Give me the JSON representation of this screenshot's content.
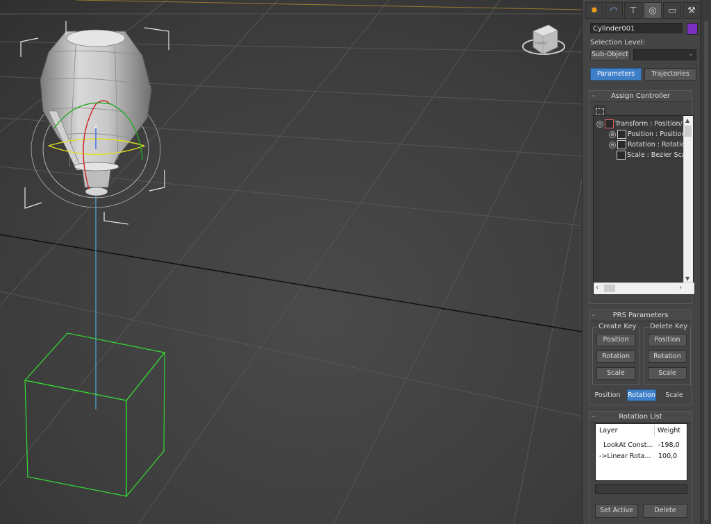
{
  "panel": {
    "tabs": [
      {
        "icon": "create-icon",
        "glyph": "✸",
        "active": false
      },
      {
        "icon": "modify-icon",
        "glyph": "◠",
        "active": false
      },
      {
        "icon": "hierarchy-icon",
        "glyph": "⊤",
        "active": false
      },
      {
        "icon": "motion-icon",
        "glyph": "◎",
        "active": true
      },
      {
        "icon": "display-icon",
        "glyph": "▭",
        "active": false
      },
      {
        "icon": "utilities-icon",
        "glyph": "⚒",
        "active": false
      }
    ],
    "object_name": "Cylinder001",
    "object_color": "#7a2fbf",
    "selection_level_label": "Selection Level:",
    "sub_object_button": "Sub-Object",
    "sub_object_dropdown_value": "",
    "parameters_button": "Parameters",
    "trajectories_button": "Trajectories"
  },
  "assign_controller": {
    "title": "Assign Controller",
    "collapse_symbol": "-",
    "tree": [
      {
        "expander": "⊖",
        "label": "Transform : Position/"
      },
      {
        "expander": "⊕",
        "label": "Position : Position"
      },
      {
        "expander": "⊕",
        "label": "Rotation : Rotatio"
      },
      {
        "expander": "",
        "label": "Scale : Bezier Sca"
      }
    ]
  },
  "prs_parameters": {
    "title": "PRS Parameters",
    "collapse_symbol": "-",
    "create_key_label": "Create Key",
    "delete_key_label": "Delete Key",
    "create_buttons": [
      "Position",
      "Rotation",
      "Scale"
    ],
    "delete_buttons": [
      "Position",
      "Rotation",
      "Scale"
    ],
    "mode_buttons": [
      {
        "label": "Position",
        "active": false
      },
      {
        "label": "Rotation",
        "active": true
      },
      {
        "label": "Scale",
        "active": false
      }
    ]
  },
  "rotation_list": {
    "title": "Rotation List",
    "collapse_symbol": "-",
    "columns": [
      "Layer",
      "Weight"
    ],
    "rows": [
      {
        "layer": "LookAt Const...",
        "weight": "-198,0"
      },
      {
        "layer": "->Linear Rota...",
        "weight": "100,0"
      }
    ],
    "weight_value": "",
    "set_active_button": "Set Active",
    "delete_button": "Delete"
  },
  "viewcube": {
    "label": "FRONT"
  }
}
